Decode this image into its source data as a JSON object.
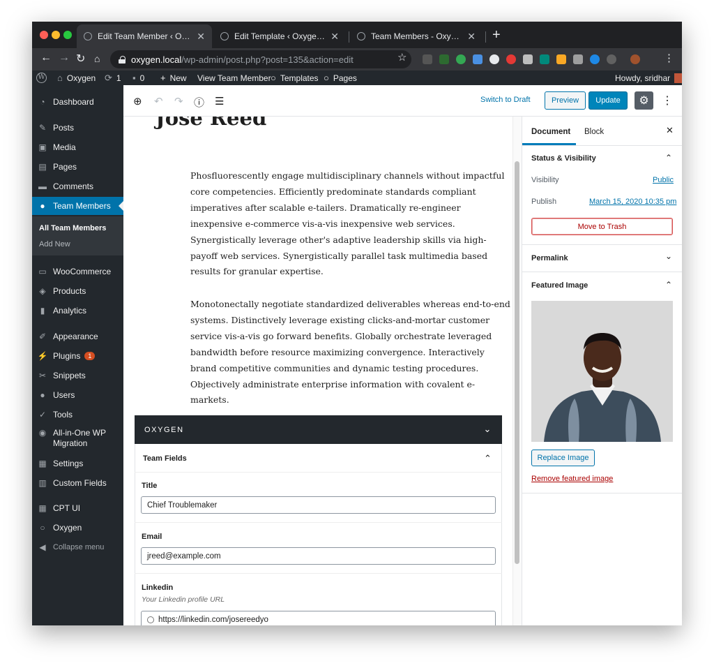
{
  "browser": {
    "tabs": [
      {
        "title": "Edit Team Member ‹ Oxygen — W"
      },
      {
        "title": "Edit Template ‹ Oxygen — Word"
      },
      {
        "title": "Team Members - Oxygen"
      }
    ],
    "url_host": "oxygen.local",
    "url_path": "/wp-admin/post.php?post=135&action=edit"
  },
  "adminbar": {
    "site": "Oxygen",
    "updates": "1",
    "comments": "0",
    "new": "New",
    "view": "View Team Member",
    "templates": "Templates",
    "pages": "Pages",
    "howdy": "Howdy, sridhar"
  },
  "sidebar": {
    "items": [
      {
        "label": "Dashboard",
        "icon": "dashboard-icon"
      },
      {
        "label": "Posts",
        "icon": "pin-icon"
      },
      {
        "label": "Media",
        "icon": "media-icon"
      },
      {
        "label": "Pages",
        "icon": "pages-icon"
      },
      {
        "label": "Comments",
        "icon": "comment-icon"
      },
      {
        "label": "Team Members",
        "icon": "user-icon"
      },
      {
        "label": "WooCommerce",
        "icon": "woo-icon"
      },
      {
        "label": "Products",
        "icon": "archive-icon"
      },
      {
        "label": "Analytics",
        "icon": "chart-icon"
      },
      {
        "label": "Appearance",
        "icon": "brush-icon"
      },
      {
        "label": "Plugins",
        "icon": "plug-icon",
        "badge": "1"
      },
      {
        "label": "Snippets",
        "icon": "scissors-icon"
      },
      {
        "label": "Users",
        "icon": "users-icon"
      },
      {
        "label": "Tools",
        "icon": "wrench-icon"
      },
      {
        "label": "All-in-One WP",
        "label2": "Migration",
        "icon": "migration-icon"
      },
      {
        "label": "Settings",
        "icon": "settings-icon"
      },
      {
        "label": "Custom Fields",
        "icon": "fields-icon"
      },
      {
        "label": "CPT UI",
        "icon": "cpt-icon"
      },
      {
        "label": "Oxygen",
        "icon": "oxygen-icon"
      },
      {
        "label": "Collapse menu",
        "icon": "collapse-icon"
      }
    ],
    "submenu": [
      "All Team Members",
      "Add New"
    ]
  },
  "toolbar": {
    "switch_draft": "Switch to Draft",
    "preview": "Preview",
    "update": "Update"
  },
  "post": {
    "title": "Jose Reed",
    "paragraphs": [
      "Phosfluorescently engage multidisciplinary channels without impactful core competencies. Efficiently predominate standards compliant imperatives after scalable e-tailers. Dramatically re-engineer inexpensive e-commerce vis-a-vis inexpensive web services. Synergistically leverage other's adaptive leadership skills via high-payoff web services. Synergistically parallel task multimedia based results for granular expertise.",
      "Monotonectally negotiate standardized deliverables whereas end-to-end systems. Distinctively leverage existing clicks-and-mortar customer service vis-a-vis go forward benefits. Globally orchestrate leveraged bandwidth before resource maximizing convergence. Interactively brand competitive communities and dynamic testing procedures. Objectively administrate enterprise information with covalent e-markets."
    ]
  },
  "oxygen": {
    "header": "OXYGEN",
    "fields_title": "Team Fields",
    "title_label": "Title",
    "title_value": "Chief Troublemaker",
    "email_label": "Email",
    "email_value": "jreed@example.com",
    "linkedin_label": "Linkedin",
    "linkedin_help": "Your Linkedin profile URL",
    "linkedin_value": "https://linkedin.com/josereedyo"
  },
  "settings": {
    "tab_document": "Document",
    "tab_block": "Block",
    "status_title": "Status & Visibility",
    "visibility_label": "Visibility",
    "visibility_value": "Public",
    "publish_label": "Publish",
    "publish_value": "March 15, 2020 10:35 pm",
    "trash": "Move to Trash",
    "permalink": "Permalink",
    "featured_title": "Featured Image",
    "replace": "Replace Image",
    "remove": "Remove featured image"
  },
  "colors": {
    "admin_dark": "#23282d",
    "wp_blue": "#0073aa",
    "update_blue": "#0085ba",
    "danger": "#aa0000"
  }
}
